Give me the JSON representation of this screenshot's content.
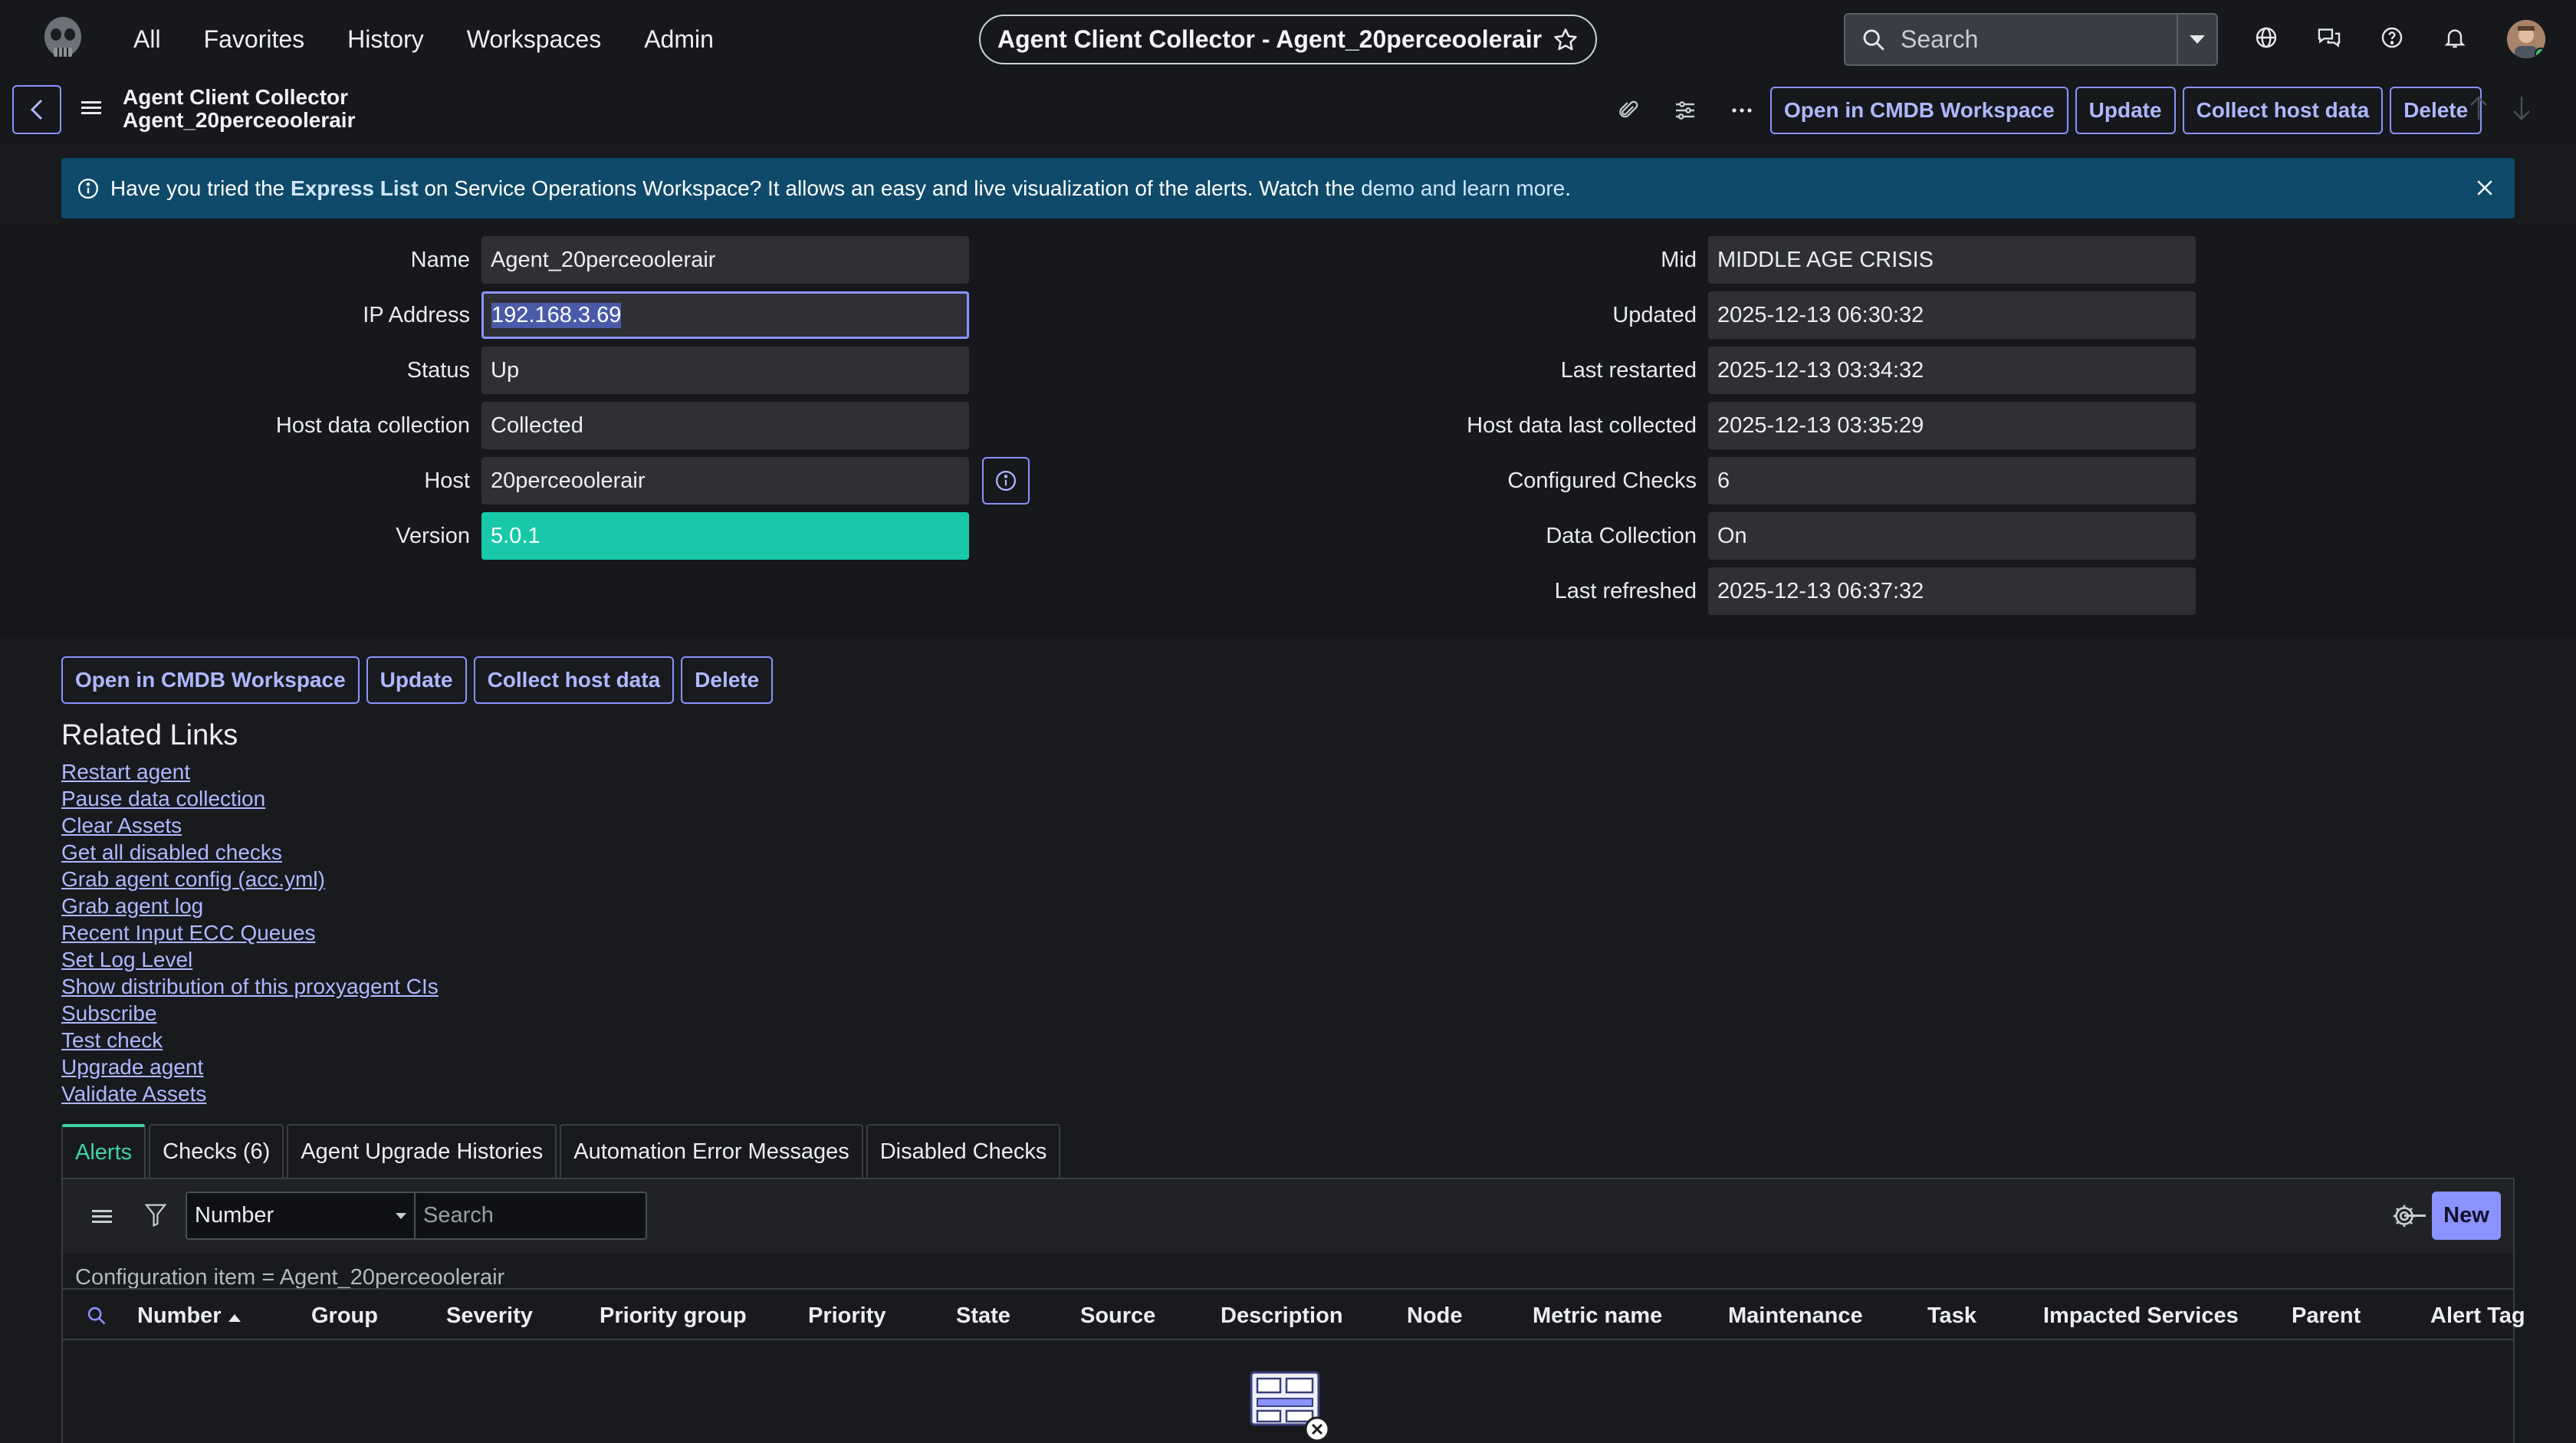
{
  "nav": {
    "menu": [
      "All",
      "Favorites",
      "History",
      "Workspaces",
      "Admin"
    ],
    "record_pill": "Agent Client Collector - Agent_20perceoolerair",
    "search_placeholder": "Search"
  },
  "record": {
    "line1": "Agent Client Collector",
    "line2": "Agent_20perceoolerair",
    "buttons": [
      "Open in CMDB Workspace",
      "Update",
      "Collect host data",
      "Delete"
    ]
  },
  "banner": {
    "pre": "Have you tried the ",
    "link1": "Express List",
    "mid": " on Service Operations Workspace? It allows an easy and live visualization of the alerts. Watch the ",
    "link2": "demo and learn more",
    "post": "."
  },
  "form_left": [
    {
      "label": "Name",
      "value": "Agent_20perceoolerair"
    },
    {
      "label": "IP Address",
      "value": "192.168.3.69"
    },
    {
      "label": "Status",
      "value": "Up"
    },
    {
      "label": "Host data collection",
      "value": "Collected"
    },
    {
      "label": "Host",
      "value": "20perceoolerair"
    },
    {
      "label": "Version",
      "value": "5.0.1"
    }
  ],
  "form_right": [
    {
      "label": "Mid",
      "value": "MIDDLE AGE CRISIS"
    },
    {
      "label": "Updated",
      "value": "2025-12-13 06:30:32"
    },
    {
      "label": "Last restarted",
      "value": "2025-12-13 03:34:32"
    },
    {
      "label": "Host data last collected",
      "value": "2025-12-13 03:35:29"
    },
    {
      "label": "Configured Checks",
      "value": "6"
    },
    {
      "label": "Data Collection",
      "value": "On"
    },
    {
      "label": "Last refreshed",
      "value": "2025-12-13 06:37:32"
    }
  ],
  "related": {
    "title": "Related Links",
    "links": [
      "Restart agent",
      "Pause data collection",
      "Clear Assets",
      "Get all disabled checks",
      "Grab agent config (acc.yml)",
      "Grab agent log",
      "Recent Input ECC Queues",
      "Set Log Level",
      "Show distribution of this proxyagent CIs",
      "Subscribe",
      "Test check",
      "Upgrade agent",
      "Validate Assets"
    ]
  },
  "tabs": [
    "Alerts",
    "Checks (6)",
    "Agent Upgrade Histories",
    "Automation Error Messages",
    "Disabled Checks"
  ],
  "list": {
    "select_value": "Number",
    "search_placeholder": "Search",
    "new_label": "New",
    "breadcrumb": "Configuration item = Agent_20perceoolerair",
    "columns": [
      "Number",
      "Group",
      "Severity",
      "Priority group",
      "Priority",
      "State",
      "Source",
      "Description",
      "Node",
      "Metric name",
      "Maintenance",
      "Task",
      "Impacted Services",
      "Parent",
      "Alert Tag"
    ]
  },
  "colors": {
    "accent": "#8a93ff",
    "banner_bg": "#0f4a6a",
    "version_green": "#17c9a9",
    "active_tab": "#3fd3a6"
  }
}
